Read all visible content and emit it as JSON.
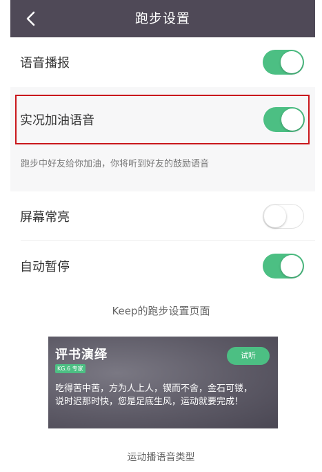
{
  "header": {
    "title": "跑步设置",
    "back_icon": "chevron-left-icon"
  },
  "settings": {
    "voice_broadcast": {
      "label": "语音播报",
      "on": true
    },
    "live_cheer_voice": {
      "label": "实况加油语音",
      "on": true
    },
    "cheer_hint": "跑步中好友给你加油，你将听到好友的鼓励语音",
    "screen_always_on": {
      "label": "屏幕常亮",
      "on": false
    },
    "auto_pause": {
      "label": "自动暂停",
      "on": true
    }
  },
  "captions": {
    "settings_caption": "Keep的跑步设置页面",
    "voice_type_caption": "运动播语音类型"
  },
  "voice_card": {
    "title": "评书演绎",
    "badge": "KG.6 专家",
    "try_label": "试听",
    "line1": "吃得苦中苦，方为人上人，锲而不舍，金石可镂，",
    "line2": "说时迟那时快，您是足底生风，运动就要完成！"
  },
  "colors": {
    "header_bg": "#4f4957",
    "toggle_on": "#4cbf83",
    "highlight_border": "#c9171c"
  }
}
